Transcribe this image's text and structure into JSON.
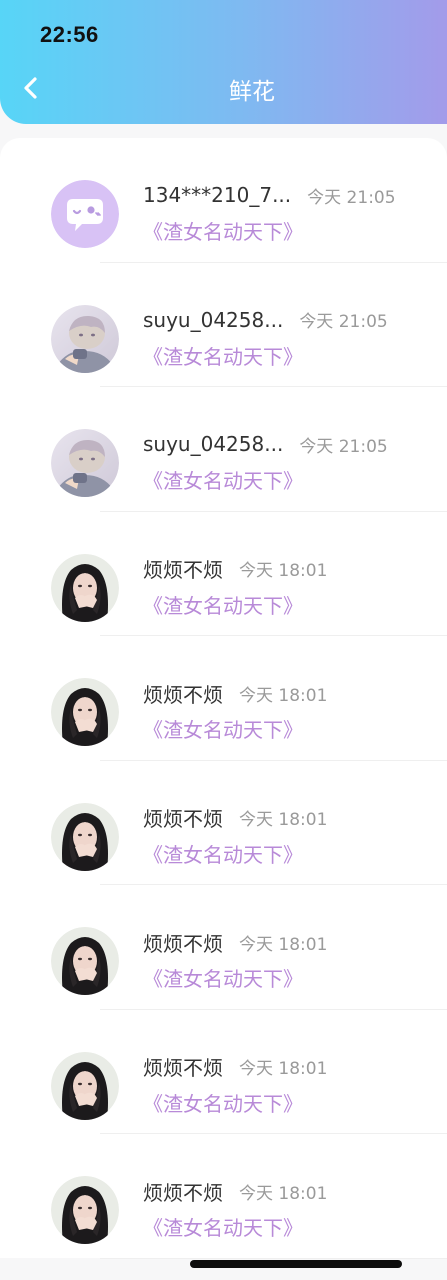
{
  "status_bar": {
    "time": "22:56"
  },
  "header": {
    "title": "鲜花",
    "back_icon": "chevron-left-icon"
  },
  "colors": {
    "header_gradient_start": "#57d5f7",
    "header_gradient_end": "#a39bea",
    "book_title": "#b88ad8",
    "timestamp": "#9a9a9a"
  },
  "items": [
    {
      "name": "134***210_7...",
      "time": "今天 21:05",
      "book": "《渣女名动天下》",
      "avatar": "wechat-bubble-avatar"
    },
    {
      "name": "suyu_04258...",
      "time": "今天 21:05",
      "book": "《渣女名动天下》",
      "avatar": "anime-boy-avatar"
    },
    {
      "name": "suyu_04258...",
      "time": "今天 21:05",
      "book": "《渣女名动天下》",
      "avatar": "anime-boy-avatar"
    },
    {
      "name": "烦烦不烦",
      "time": "今天 18:01",
      "book": "《渣女名动天下》",
      "avatar": "girl-photo-avatar"
    },
    {
      "name": "烦烦不烦",
      "time": "今天 18:01",
      "book": "《渣女名动天下》",
      "avatar": "girl-photo-avatar"
    },
    {
      "name": "烦烦不烦",
      "time": "今天 18:01",
      "book": "《渣女名动天下》",
      "avatar": "girl-photo-avatar"
    },
    {
      "name": "烦烦不烦",
      "time": "今天 18:01",
      "book": "《渣女名动天下》",
      "avatar": "girl-photo-avatar"
    },
    {
      "name": "烦烦不烦",
      "time": "今天 18:01",
      "book": "《渣女名动天下》",
      "avatar": "girl-photo-avatar"
    },
    {
      "name": "烦烦不烦",
      "time": "今天 18:01",
      "book": "《渣女名动天下》",
      "avatar": "girl-photo-avatar"
    }
  ]
}
